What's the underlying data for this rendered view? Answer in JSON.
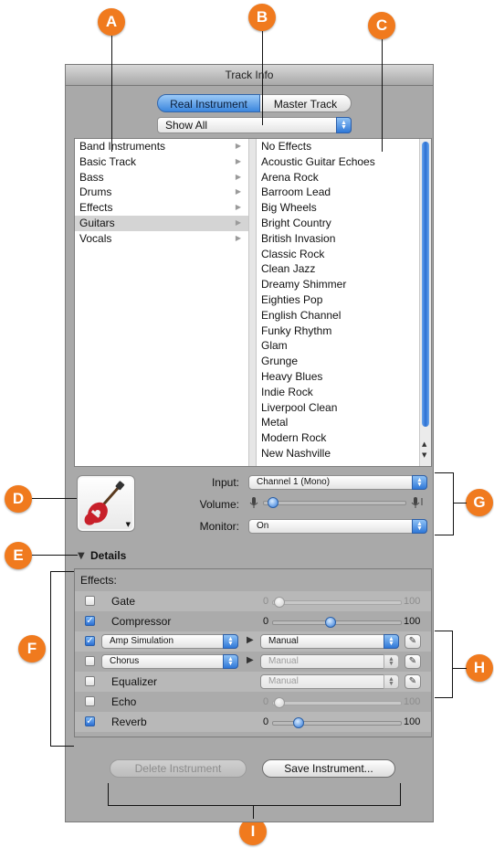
{
  "callouts": {
    "a": "A",
    "b": "B",
    "c": "C",
    "d": "D",
    "e": "E",
    "f": "F",
    "g": "G",
    "h": "H",
    "i": "I"
  },
  "window": {
    "title": "Track Info"
  },
  "mode_tabs": {
    "real_instrument": "Real Instrument",
    "master_track": "Master Track"
  },
  "filter_popup": {
    "value": "Show All"
  },
  "categories": [
    "Band Instruments",
    "Basic Track",
    "Bass",
    "Drums",
    "Effects",
    "Guitars",
    "Vocals"
  ],
  "selected_category": "Guitars",
  "presets": [
    "No Effects",
    "Acoustic Guitar Echoes",
    "Arena Rock",
    "Barroom Lead",
    "Big Wheels",
    "Bright Country",
    "British Invasion",
    "Classic Rock",
    "Clean Jazz",
    "Dreamy Shimmer",
    "Eighties Pop",
    "English Channel",
    "Funky Rhythm",
    "Glam",
    "Grunge",
    "Heavy Blues",
    "Indie Rock",
    "Liverpool Clean",
    "Metal",
    "Modern Rock",
    "New Nashville"
  ],
  "track_controls": {
    "input_label": "Input:",
    "input_value": "Channel 1 (Mono)",
    "volume_label": "Volume:",
    "volume_level": 0.03,
    "monitor_label": "Monitor:",
    "monitor_value": "On"
  },
  "details": {
    "label": "Details",
    "effects_label": "Effects:"
  },
  "effects": {
    "gate": {
      "name": "Gate",
      "checked": false,
      "min": "0",
      "max": "100",
      "level": 0.05
    },
    "compressor": {
      "name": "Compressor",
      "checked": true,
      "min": "0",
      "max": "100",
      "level": 0.45
    },
    "amp_simulation": {
      "name": "Amp Simulation",
      "checked": true,
      "preset": "Manual"
    },
    "chorus": {
      "name": "Chorus",
      "checked": false,
      "preset": "Manual"
    },
    "equalizer": {
      "name": "Equalizer",
      "checked": false,
      "preset": "Manual"
    },
    "echo": {
      "name": "Echo",
      "checked": false,
      "min": "0",
      "max": "100",
      "level": 0.05
    },
    "reverb": {
      "name": "Reverb",
      "checked": true,
      "min": "0",
      "max": "100",
      "level": 0.2
    }
  },
  "buttons": {
    "delete": "Delete Instrument",
    "save": "Save Instrument..."
  },
  "colors": {
    "callout": "#f07a1e",
    "accent": "#2f78d8"
  }
}
